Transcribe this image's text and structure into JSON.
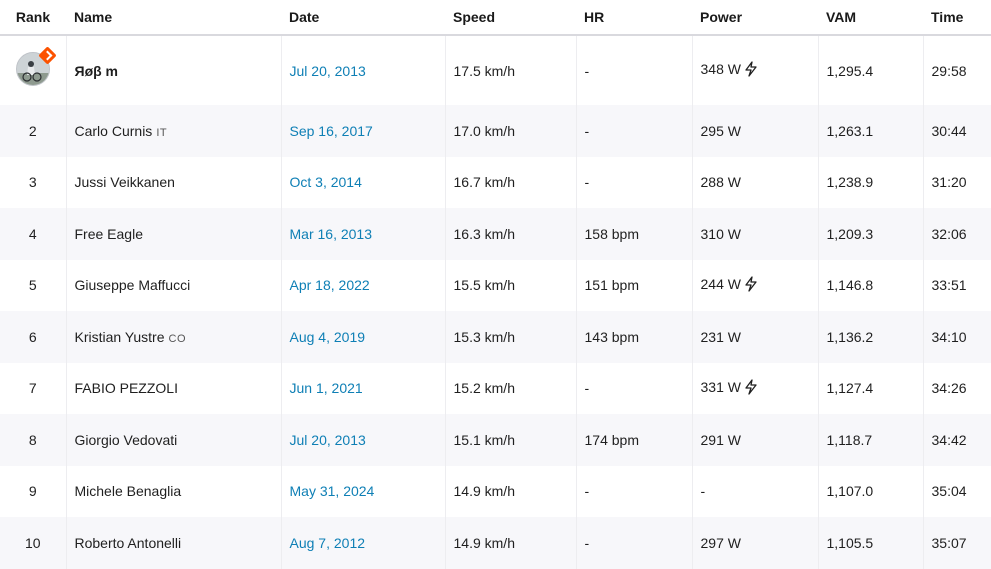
{
  "headers": {
    "rank": "Rank",
    "name": "Name",
    "date": "Date",
    "speed": "Speed",
    "hr": "HR",
    "power": "Power",
    "vam": "VAM",
    "time": "Time"
  },
  "rows": [
    {
      "rank": "",
      "name": "Яøβ m",
      "country": "",
      "date": "Jul 20, 2013",
      "speed": "17.5 km/h",
      "hr": "-",
      "power": "348 W",
      "power_device": true,
      "vam": "1,295.4",
      "time": "29:58"
    },
    {
      "rank": "2",
      "name": "Carlo Curnis",
      "country": "IT",
      "date": "Sep 16, 2017",
      "speed": "17.0 km/h",
      "hr": "-",
      "power": "295 W",
      "power_device": false,
      "vam": "1,263.1",
      "time": "30:44"
    },
    {
      "rank": "3",
      "name": "Jussi Veikkanen",
      "country": "",
      "date": "Oct 3, 2014",
      "speed": "16.7 km/h",
      "hr": "-",
      "power": "288 W",
      "power_device": false,
      "vam": "1,238.9",
      "time": "31:20"
    },
    {
      "rank": "4",
      "name": "Free Eagle",
      "country": "",
      "date": "Mar 16, 2013",
      "speed": "16.3 km/h",
      "hr": "158 bpm",
      "power": "310 W",
      "power_device": false,
      "vam": "1,209.3",
      "time": "32:06"
    },
    {
      "rank": "5",
      "name": "Giuseppe Maffucci",
      "country": "",
      "date": "Apr 18, 2022",
      "speed": "15.5 km/h",
      "hr": "151 bpm",
      "power": "244 W",
      "power_device": true,
      "vam": "1,146.8",
      "time": "33:51"
    },
    {
      "rank": "6",
      "name": "Kristian Yustre",
      "country": "CO",
      "date": "Aug 4, 2019",
      "speed": "15.3 km/h",
      "hr": "143 bpm",
      "power": "231 W",
      "power_device": false,
      "vam": "1,136.2",
      "time": "34:10"
    },
    {
      "rank": "7",
      "name": "FABIO PEZZOLI",
      "country": "",
      "date": "Jun 1, 2021",
      "speed": "15.2 km/h",
      "hr": "-",
      "power": "331 W",
      "power_device": true,
      "vam": "1,127.4",
      "time": "34:26"
    },
    {
      "rank": "8",
      "name": "Giorgio Vedovati",
      "country": "",
      "date": "Jul 20, 2013",
      "speed": "15.1 km/h",
      "hr": "174 bpm",
      "power": "291 W",
      "power_device": false,
      "vam": "1,118.7",
      "time": "34:42"
    },
    {
      "rank": "9",
      "name": "Michele Benaglia",
      "country": "",
      "date": "May 31, 2024",
      "speed": "14.9 km/h",
      "hr": "-",
      "power": "-",
      "power_device": false,
      "vam": "1,107.0",
      "time": "35:04"
    },
    {
      "rank": "10",
      "name": "Roberto Antonelli",
      "country": "",
      "date": "Aug 7, 2012",
      "speed": "14.9 km/h",
      "hr": "-",
      "power": "297 W",
      "power_device": false,
      "vam": "1,105.5",
      "time": "35:07"
    }
  ],
  "colors": {
    "link": "#0e7fb5",
    "brand": "#fc5200",
    "alt_row": "#f7f7fa"
  },
  "icons": {
    "power_device": "lightning-bolt-icon",
    "crown": "crown-badge-icon"
  }
}
